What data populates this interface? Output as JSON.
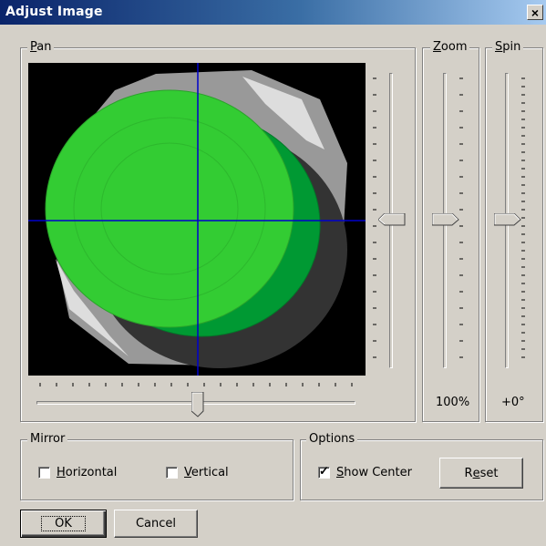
{
  "window": {
    "title": "Adjust Image",
    "close_label": "×"
  },
  "pan": {
    "label_first": "P",
    "label_rest": "an",
    "show_center_crosshair": true,
    "horizontal_slider": {
      "position": 0.5
    },
    "vertical_slider": {
      "position": 0.5
    }
  },
  "zoom": {
    "label_first": "Z",
    "label_rest": "oom",
    "value": "100%",
    "slider": {
      "position": 0.5
    }
  },
  "spin": {
    "label_first": "S",
    "label_rest": "pin",
    "value": "+0°",
    "slider": {
      "position": 0.5
    }
  },
  "mirror": {
    "label": "Mirror",
    "horizontal": {
      "label_first": "H",
      "label_rest": "orizontal",
      "checked": false
    },
    "vertical": {
      "label_first": "V",
      "label_rest": "ertical",
      "checked": false
    }
  },
  "options": {
    "label": "Options",
    "show_center": {
      "label_first": "S",
      "label_rest": "how Center",
      "checked": true,
      "check_mark": "✓"
    },
    "reset": {
      "label_pre": "R",
      "label_u": "e",
      "label_post": "set"
    }
  },
  "buttons": {
    "ok": "OK",
    "cancel": "Cancel"
  },
  "colors": {
    "button_face": "#d4d0c8",
    "title_start": "#0a246a",
    "title_end": "#a6caf0",
    "circle_front": "#33cc33",
    "circle_back": "#009933",
    "shadow": "#333333",
    "highlight": "#999999",
    "crosshair": "#0000cc"
  }
}
